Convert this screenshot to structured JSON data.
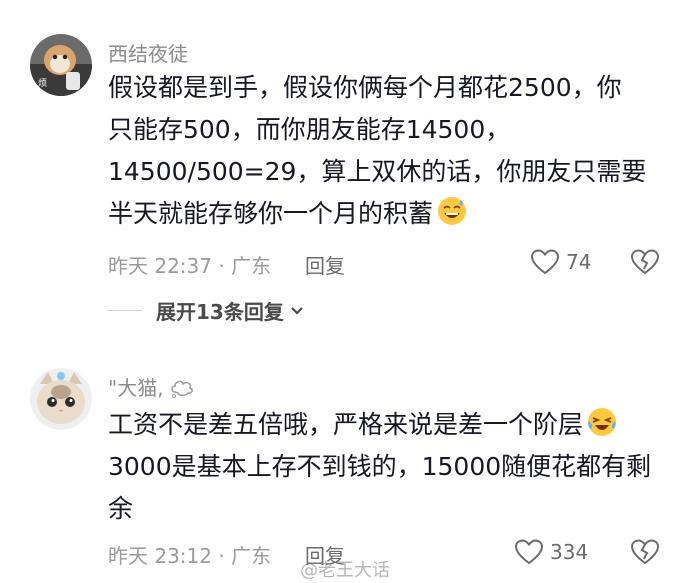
{
  "comments": [
    {
      "username": "西结夜徒",
      "lines": [
        "假设都是到手，假设你俩每个月都花2500，你",
        "只能存500，而你朋友能存14500，",
        "14500/500=29，算上双休的话，你朋友只需要",
        "半天就能存够你一个月的积蓄"
      ],
      "emoji": "grinning-sweat-emoji",
      "time": "昨天 22:37",
      "location": "广东",
      "reply_label": "回复",
      "likes": "74"
    },
    {
      "username": "\"大猫,",
      "username_icon": "thought-bubble-icon",
      "lines": [
        "工资不是差五倍哦，严格来说是差一个阶层",
        "3000是基本上存不到钱的，15000随便花都有剩",
        "余"
      ],
      "emoji": "laughing-tears-emoji",
      "time": "昨天 23:12",
      "location": "广东",
      "reply_label": "回复",
      "likes": "334"
    }
  ],
  "expand_replies": {
    "label": "展开13条回复"
  },
  "watermark": "@老王大话"
}
